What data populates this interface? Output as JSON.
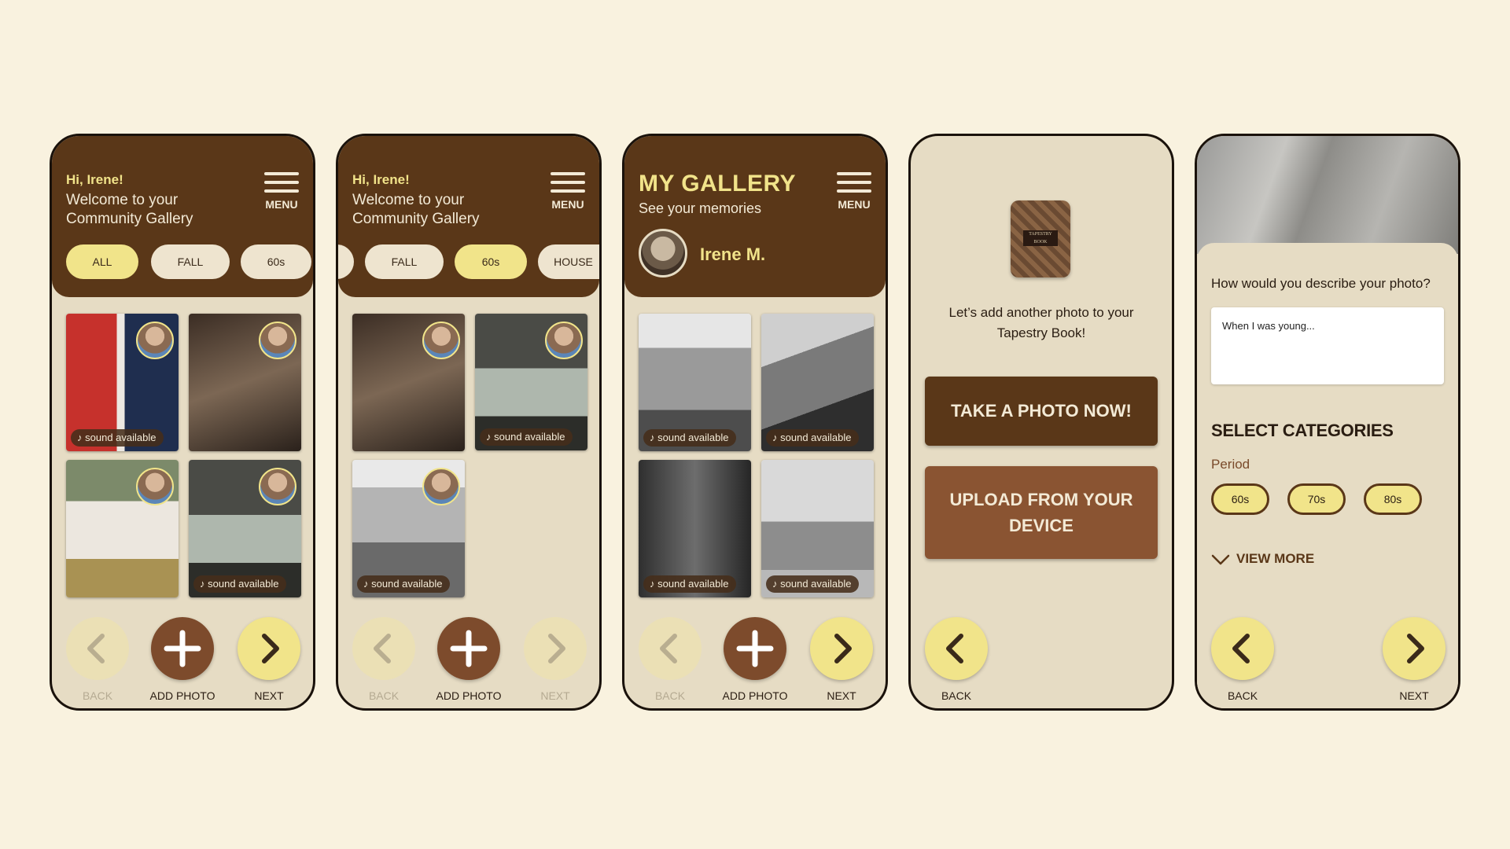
{
  "common": {
    "greeting": "Hi, Irene!",
    "welcome": "Welcome to your Community Gallery",
    "menu_label": "MENU",
    "sound_label": "sound available",
    "back_label": "BACK",
    "add_photo_label": "ADD PHOTO",
    "next_label": "NEXT"
  },
  "screen1": {
    "chips": [
      "ALL",
      "FALL",
      "60s"
    ],
    "selected_chip": "ALL"
  },
  "screen2": {
    "chips": [
      "FALL",
      "60s",
      "HOUSE"
    ],
    "selected_chip": "60s"
  },
  "screen3": {
    "title": "MY GALLERY",
    "subtitle": "See your memories",
    "user_name": "Irene M."
  },
  "screen4": {
    "book_label": "TAPESTRY BOOK",
    "prompt": "Let’s add another photo to your Tapestry Book!",
    "take_photo": "TAKE A PHOTO NOW!",
    "upload": "UPLOAD FROM YOUR DEVICE"
  },
  "screen5": {
    "question": "How would you describe your photo?",
    "placeholder": "When I was young...",
    "select_categories": "SELECT CATEGORIES",
    "period_label": "Period",
    "periods": [
      "60s",
      "70s",
      "80s"
    ],
    "view_more": "VIEW MORE"
  },
  "colors": {
    "brown": "#5a3718",
    "yellow": "#f1e48a",
    "cream": "#f9f2df",
    "panel": "#e6dcc4"
  }
}
